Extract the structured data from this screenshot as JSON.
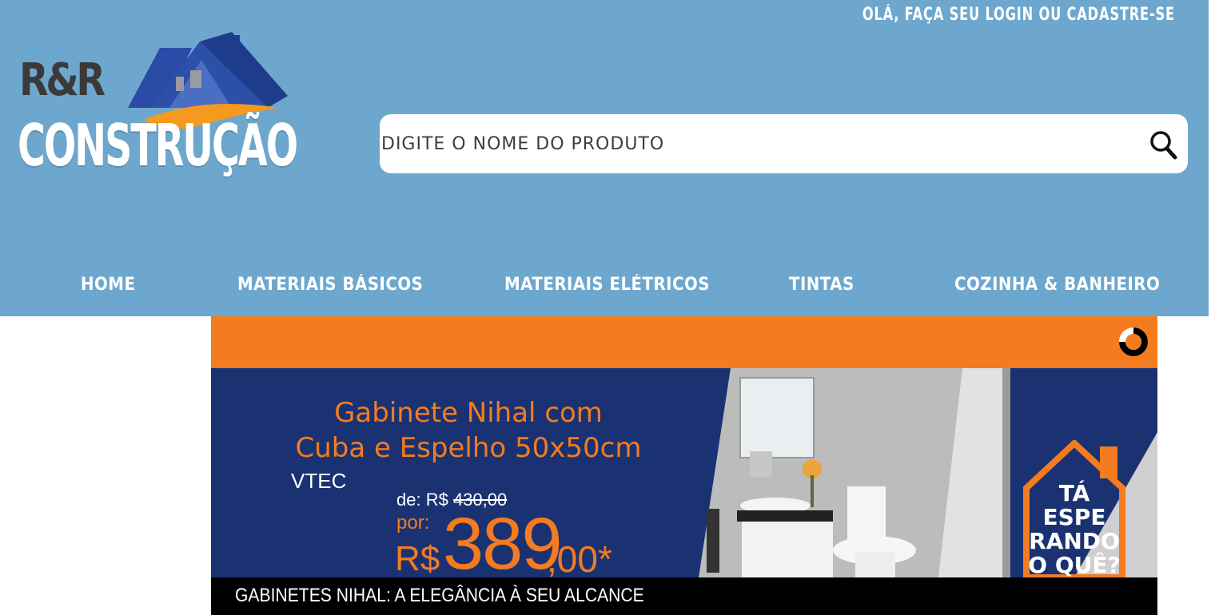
{
  "header": {
    "login_text": "OLÁ, FAÇA SEU LOGIN OU CADASTRE-SE",
    "logo": {
      "line1": "R&R",
      "line2": "CONSTRUÇÃO"
    },
    "search": {
      "placeholder": "DIGITE O NOME DO PRODUTO",
      "value": "",
      "icon": "search-icon"
    }
  },
  "nav": {
    "items": [
      {
        "label": "HOME"
      },
      {
        "label": "MATERIAIS BÁSICOS"
      },
      {
        "label": "MATERIAIS ELÉTRICOS"
      },
      {
        "label": "TINTAS"
      },
      {
        "label": "COZINHA & BANHEIRO"
      }
    ]
  },
  "banner": {
    "loader_icon": "loading-spinner-icon",
    "title_line1": "Gabinete Nihal  com",
    "title_line2": "Cuba e Espelho 50x50cm",
    "brand": "VTEC",
    "price_old_prefix": "de: R$ ",
    "price_old_value": "430,00",
    "price_new_prefix": "por:",
    "currency": "R$",
    "price_new_int": "389",
    "price_new_cents": ",00*",
    "badge": {
      "line1": "TÁ",
      "line2": "ESPE",
      "line3": "RANDO",
      "line4": "O QUÊ?"
    },
    "caption": "GABINETES NIHAL: A ELEGÂNCIA À SEU ALCANCE"
  },
  "colors": {
    "header_bg": "#6ea7ce",
    "accent_orange": "#f47b1f",
    "banner_navy": "#1a3272",
    "caption_bg": "#000000"
  }
}
